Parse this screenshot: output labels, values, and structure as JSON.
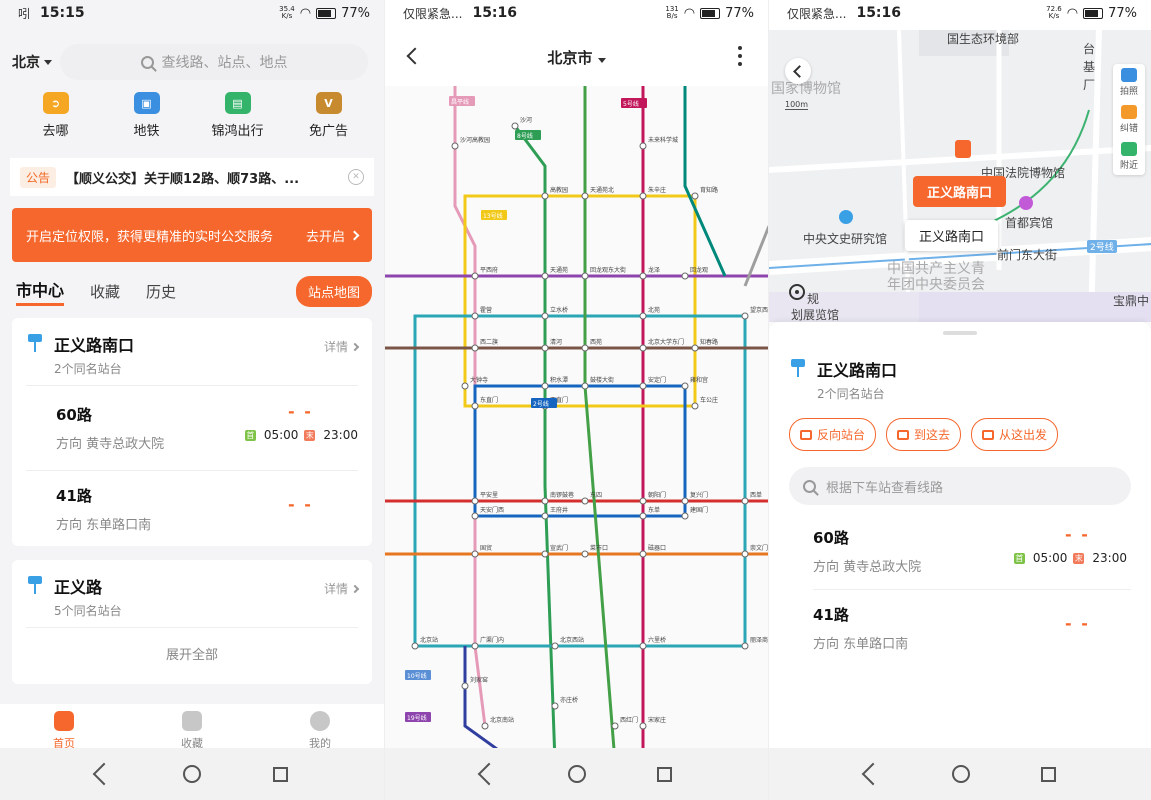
{
  "panel1": {
    "status": {
      "carrier": "吲",
      "time": "15:15",
      "net_speed_top": "35.4",
      "net_speed_unit": "K/s",
      "battery": "77%"
    },
    "city": "北京",
    "search_placeholder": "查线路、站点、地点",
    "quick": [
      {
        "label": "去哪",
        "icon": "route-icon",
        "color": "#f5a623"
      },
      {
        "label": "地铁",
        "icon": "subway-icon",
        "color": "#3a8fe0"
      },
      {
        "label": "锦鸿出行",
        "icon": "bus-icon",
        "color": "#34b36b"
      },
      {
        "label": "免广告",
        "icon": "vip-icon",
        "color": "#c88a2e"
      }
    ],
    "notice": {
      "tag": "公告",
      "text": "【顺义公交】关于顺12路、顺73路、..."
    },
    "banner": {
      "text": "开启定位权限，获得更精准的实时公交服务",
      "action": "去开启"
    },
    "tabs": {
      "center": "市中心",
      "fav": "收藏",
      "history": "历史",
      "map_btn": "站点地图"
    },
    "stop1": {
      "name": "正义路南口",
      "sub": "2个同名站台",
      "detail": "详情",
      "routes": [
        {
          "name": "60路",
          "dir": "方向 黄寺总政大院",
          "eta": "- -",
          "first": "05:00",
          "last": "23:00",
          "first_badge": "首",
          "last_badge": "末"
        },
        {
          "name": "41路",
          "dir": "方向 东单路口南",
          "eta": "- -"
        }
      ]
    },
    "stop2": {
      "name": "正义路",
      "sub": "5个同名站台",
      "detail": "详情",
      "expand": "展开全部"
    },
    "bottom_nav": [
      {
        "label": "首页",
        "icon": "home-icon"
      },
      {
        "label": "收藏",
        "icon": "star-icon"
      },
      {
        "label": "我的",
        "icon": "profile-icon"
      }
    ]
  },
  "panel2": {
    "status": {
      "carrier": "仅限紧急...",
      "time": "15:16",
      "net_speed_top": "131",
      "net_speed_unit": "B/s",
      "battery": "77%"
    },
    "title": "北京市",
    "line_tags": [
      "昌平线",
      "5号线",
      "8号线",
      "13号线",
      "2号线",
      "10号线",
      "19号线"
    ],
    "stations": [
      "沙河高教园",
      "未来科学城",
      "沙河",
      "高教园",
      "天通苑北",
      "朱辛庄",
      "育知路",
      "平西府",
      "天通苑",
      "回龙观东大街",
      "龙泽",
      "回龙观",
      "霍营",
      "立水桥",
      "北苑",
      "望京西",
      "西二旗",
      "清河",
      "西苑",
      "北京大学东门",
      "知春路",
      "大钟寺",
      "积水潭",
      "鼓楼大街",
      "安定门",
      "雍和宫",
      "东直门",
      "西直门",
      "车公庄",
      "平安里",
      "南锣鼓巷",
      "东四",
      "朝阳门",
      "复兴门",
      "西单",
      "天安门西",
      "王府井",
      "东单",
      "建国门",
      "国贸",
      "宣武门",
      "菜市口",
      "磁器口",
      "崇文门",
      "北京站",
      "广渠门内",
      "北京西站",
      "六里桥",
      "丽泽商务区",
      "北京南站",
      "宋家庄",
      "刘家窑",
      "亦庄桥",
      "西红门",
      "高米店北"
    ]
  },
  "panel3": {
    "status": {
      "carrier": "仅限紧急...",
      "time": "15:16",
      "net_speed_top": "72.6",
      "net_speed_unit": "K/s",
      "battery": "77%"
    },
    "map_labels": [
      "国生态环境部",
      "国家博物馆",
      "中国法院博物馆",
      "首都宾馆",
      "中央文史研究馆",
      "前门东大街",
      "中国共产主义青",
      "年团中央委员会",
      "宝鼎中",
      "划展览馆",
      "规",
      "台",
      "基",
      "厂"
    ],
    "scale": "100m",
    "road_tag": "2号线",
    "callout_primary": "正义路南口",
    "callout_secondary": "正义路南口",
    "tools": [
      {
        "label": "拍照",
        "icon": "camera-icon"
      },
      {
        "label": "纠错",
        "icon": "report-icon"
      },
      {
        "label": "附近",
        "icon": "nearby-icon"
      }
    ],
    "stop": {
      "name": "正义路南口",
      "sub": "2个同名站台"
    },
    "actions": [
      {
        "label": "反向站台",
        "icon": "swap-icon"
      },
      {
        "label": "到这去",
        "icon": "go-here-icon"
      },
      {
        "label": "从这出发",
        "icon": "depart-icon"
      }
    ],
    "search_placeholder": "根据下车站查看线路",
    "routes": [
      {
        "name": "60路",
        "dir": "方向 黄寺总政大院",
        "eta": "- -",
        "first": "05:00",
        "last": "23:00",
        "first_badge": "首",
        "last_badge": "末"
      },
      {
        "name": "41路",
        "dir": "方向 东单路口南",
        "eta": "- -"
      }
    ]
  }
}
